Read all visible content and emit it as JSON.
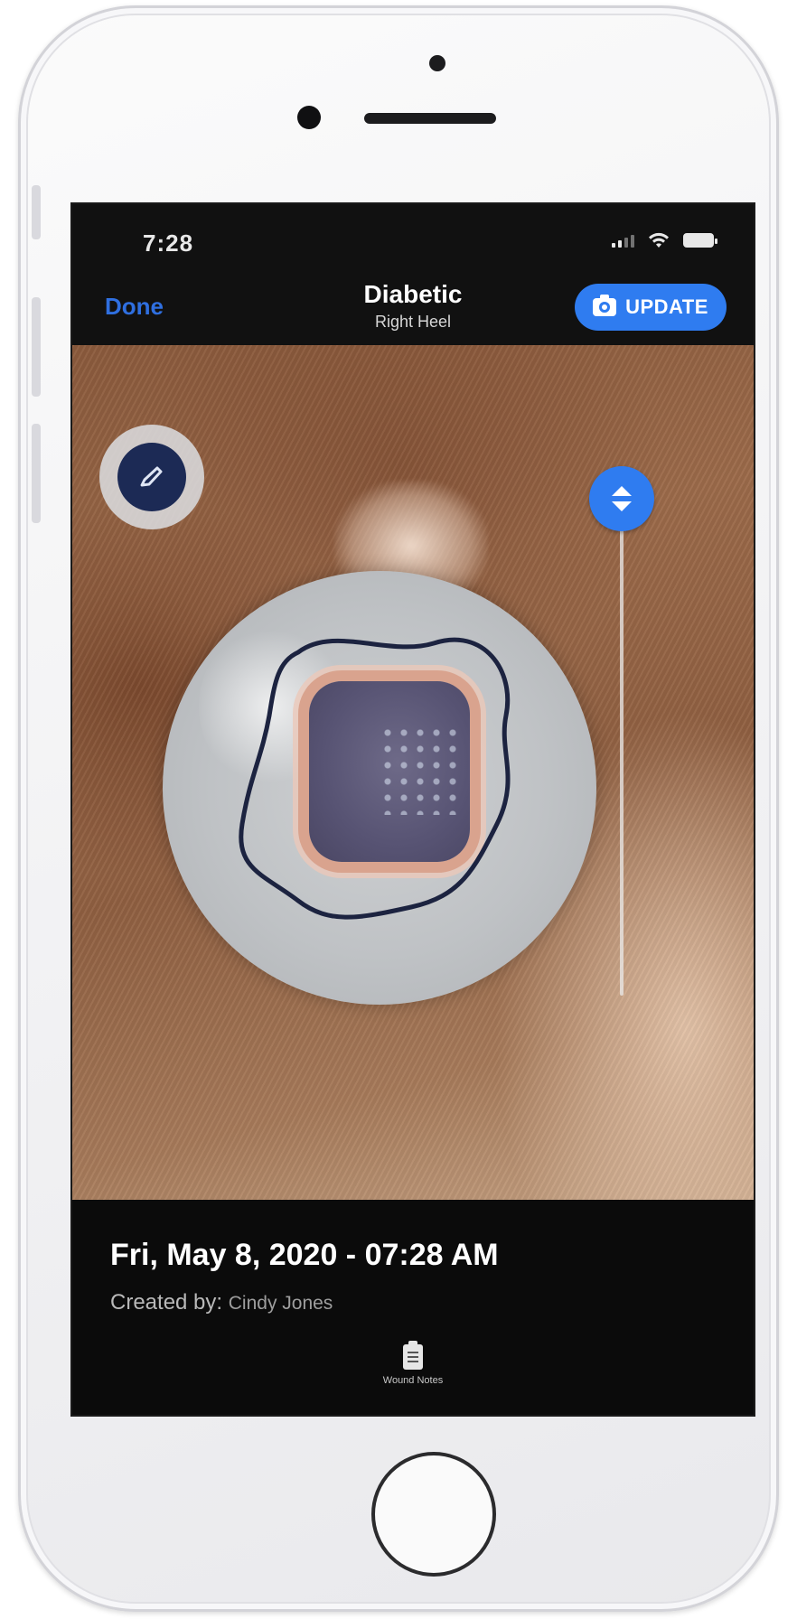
{
  "status_bar": {
    "time": "7:28"
  },
  "nav": {
    "done_label": "Done",
    "title": "Diabetic",
    "subtitle": "Right Heel",
    "update_label": "UPDATE"
  },
  "info": {
    "date": "Fri, May 8, 2020 - 07:28 AM",
    "created_by_label": "Created by:",
    "created_by_name": "Cindy Jones",
    "notes_label": "Wound Notes"
  },
  "colors": {
    "accent": "#2f7cf0",
    "done_link": "#2f6fe0",
    "drawing_tool": "#1c2a55",
    "outline": "#1c2340"
  },
  "icons": {
    "draw_tool": "pencil-icon",
    "update": "camera-icon",
    "slider": "up-down-arrows-icon",
    "notes": "clipboard-icon"
  }
}
